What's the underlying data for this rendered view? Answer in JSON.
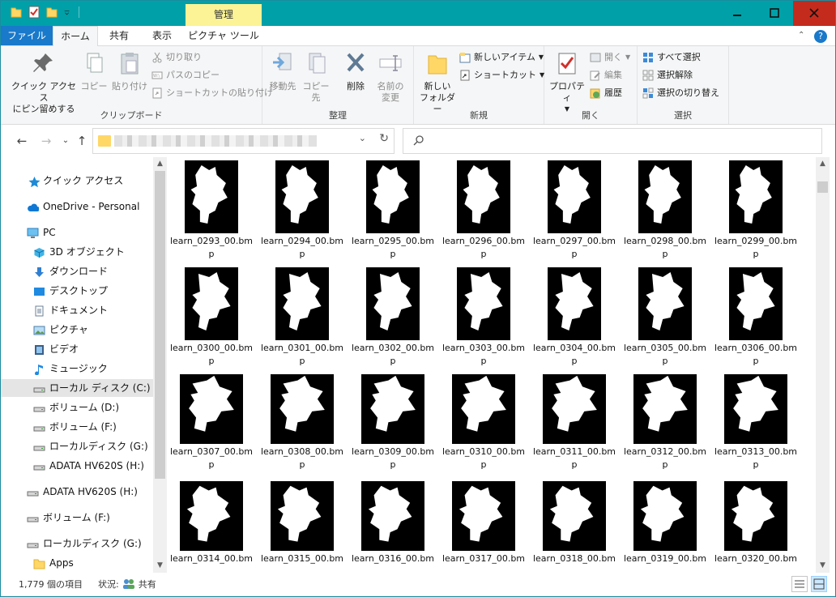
{
  "window": {
    "manage_tab": "管理"
  },
  "tabs": {
    "file": "ファイル",
    "home": "ホーム",
    "share": "共有",
    "view": "表示",
    "picture_tools": "ピクチャ ツール"
  },
  "ribbon": {
    "clipboard": {
      "label": "クリップボード",
      "pin_line1": "クイック アクセス",
      "pin_line2": "にピン留めする",
      "copy": "コピー",
      "paste": "貼り付け",
      "cut": "切り取り",
      "copy_path": "パスのコピー",
      "paste_shortcut": "ショートカットの貼り付け"
    },
    "organize": {
      "label": "整理",
      "move_to": "移動先",
      "copy_to": "コピー先",
      "delete": "削除",
      "rename_line1": "名前の",
      "rename_line2": "変更"
    },
    "new": {
      "label": "新規",
      "new_folder_line1": "新しい",
      "new_folder_line2": "フォルダー",
      "new_item": "新しいアイテム",
      "shortcut": "ショートカット"
    },
    "open": {
      "label": "開く",
      "properties": "プロパティ",
      "open": "開く",
      "edit": "編集",
      "history": "履歴"
    },
    "select": {
      "label": "選択",
      "select_all": "すべて選択",
      "select_none": "選択解除",
      "invert": "選択の切り替え"
    }
  },
  "nav": {
    "items": [
      {
        "label": "クイック アクセス",
        "icon": "star-icon"
      },
      {
        "label": "OneDrive - Personal",
        "icon": "cloud-icon"
      },
      {
        "label": "PC",
        "icon": "pc-icon"
      },
      {
        "label": "3D オブジェクト",
        "icon": "3d-icon"
      },
      {
        "label": "ダウンロード",
        "icon": "download-icon"
      },
      {
        "label": "デスクトップ",
        "icon": "desktop-icon"
      },
      {
        "label": "ドキュメント",
        "icon": "document-icon"
      },
      {
        "label": "ピクチャ",
        "icon": "picture-icon"
      },
      {
        "label": "ビデオ",
        "icon": "video-icon"
      },
      {
        "label": "ミュージック",
        "icon": "music-icon"
      },
      {
        "label": "ローカル ディスク (C:)",
        "icon": "drive-icon"
      },
      {
        "label": "ボリューム (D:)",
        "icon": "drive-icon"
      },
      {
        "label": "ボリューム (F:)",
        "icon": "drive-icon"
      },
      {
        "label": "ローカルディスク (G:)",
        "icon": "drive-icon"
      },
      {
        "label": "ADATA HV620S (H:)",
        "icon": "drive-icon"
      },
      {
        "label": "ADATA HV620S (H:)",
        "icon": "drive-icon"
      },
      {
        "label": "ボリューム (F:)",
        "icon": "drive-icon"
      },
      {
        "label": "ローカルディスク (G:)",
        "icon": "drive-icon"
      },
      {
        "label": "Apps",
        "icon": "folder-icon"
      }
    ]
  },
  "files": [
    "learn_0293_00.bmp",
    "learn_0294_00.bmp",
    "learn_0295_00.bmp",
    "learn_0296_00.bmp",
    "learn_0297_00.bmp",
    "learn_0298_00.bmp",
    "learn_0299_00.bmp",
    "learn_0300_00.bmp",
    "learn_0301_00.bmp",
    "learn_0302_00.bmp",
    "learn_0303_00.bmp",
    "learn_0304_00.bmp",
    "learn_0305_00.bmp",
    "learn_0306_00.bmp",
    "learn_0307_00.bmp",
    "learn_0308_00.bmp",
    "learn_0309_00.bmp",
    "learn_0310_00.bmp",
    "learn_0311_00.bmp",
    "learn_0312_00.bmp",
    "learn_0313_00.bmp",
    "learn_0314_00.bm",
    "learn_0315_00.bm",
    "learn_0316_00.bm",
    "learn_0317_00.bm",
    "learn_0318_00.bm",
    "learn_0319_00.bm",
    "learn_0320_00.bm"
  ],
  "status": {
    "count": "1,779 個の項目",
    "state_label": "状況:",
    "state_value": "共有"
  },
  "colors": {
    "titlebar": "#00a0a8",
    "file_tab": "#1979ca",
    "manage_tab": "#fbf395",
    "close": "#c42b1c"
  }
}
